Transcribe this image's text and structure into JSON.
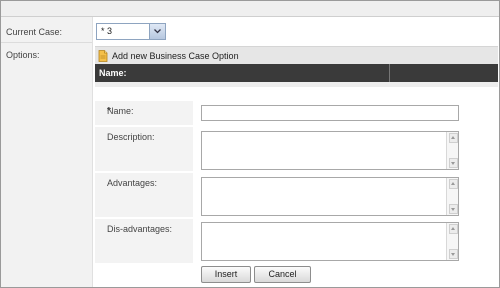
{
  "form": {
    "current_case_label": "Current Case:",
    "current_case_value": "* 3",
    "options_label": "Options:",
    "add_option_label": "Add new Business Case Option",
    "grid_column_name": "Name:",
    "name_label": "Name:",
    "description_label": "Description:",
    "advantages_label": "Advantages:",
    "disadvantages_label": "Dis-advantages:",
    "required_mark": "*",
    "insert_label": "Insert",
    "cancel_label": "Cancel",
    "name_value": "",
    "description_value": "",
    "advantages_value": "",
    "disadvantages_value": ""
  },
  "icons": {
    "dropdown": "chevron-down-icon",
    "add_option": "document-add-icon"
  },
  "colors": {
    "grid_header": "#3a3a3a",
    "required": "#dd2222",
    "select_border": "#8ea4c0"
  }
}
